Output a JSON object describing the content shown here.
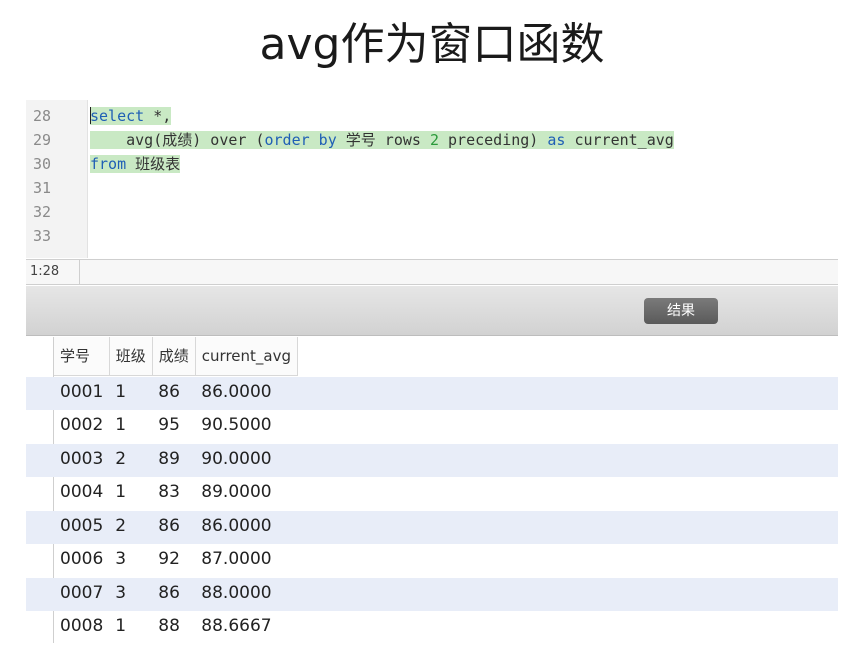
{
  "title": "avg作为窗口函数",
  "editor": {
    "line_numbers": [
      "28",
      "29",
      "30",
      "31",
      "32",
      "33"
    ],
    "line1": {
      "kw": "select",
      "rest": " *,"
    },
    "line2": {
      "a": "    avg(成绩) over (",
      "kw1": "order by",
      "b": " 学号 rows ",
      "num": "2",
      "c": " preceding) ",
      "kw2": "as",
      "d": " current_avg"
    },
    "line3": {
      "kw": "from",
      "rest": " 班级表"
    }
  },
  "status": {
    "cursor_pos": "1:28"
  },
  "results": {
    "tab_label": "结果",
    "columns": [
      "学号",
      "班级",
      "成绩",
      "current_avg"
    ],
    "rows": [
      [
        "0001",
        "1",
        "86",
        "86.0000"
      ],
      [
        "0002",
        "1",
        "95",
        "90.5000"
      ],
      [
        "0003",
        "2",
        "89",
        "90.0000"
      ],
      [
        "0004",
        "1",
        "83",
        "89.0000"
      ],
      [
        "0005",
        "2",
        "86",
        "86.0000"
      ],
      [
        "0006",
        "3",
        "92",
        "87.0000"
      ],
      [
        "0007",
        "3",
        "86",
        "88.0000"
      ],
      [
        "0008",
        "1",
        "88",
        "88.6667"
      ]
    ]
  }
}
